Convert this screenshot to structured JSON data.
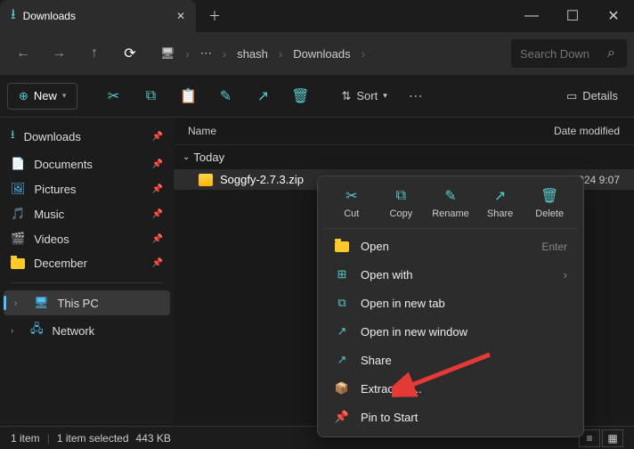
{
  "titlebar": {
    "tab_title": "Downloads"
  },
  "breadcrumb": {
    "dots": "⋯",
    "p1": "shash",
    "p2": "Downloads"
  },
  "search": {
    "placeholder": "Search Down"
  },
  "toolbar": {
    "new": "New",
    "sort": "Sort",
    "details": "Details"
  },
  "sidebar": {
    "items": [
      {
        "label": "Downloads",
        "icon": "download"
      },
      {
        "label": "Documents",
        "icon": "doc"
      },
      {
        "label": "Pictures",
        "icon": "pic"
      },
      {
        "label": "Music",
        "icon": "music"
      },
      {
        "label": "Videos",
        "icon": "video"
      },
      {
        "label": "December",
        "icon": "folder"
      }
    ],
    "thispc": "This PC",
    "network": "Network"
  },
  "columns": {
    "name": "Name",
    "date": "Date modified"
  },
  "group": "Today",
  "file": {
    "name": "Soggfy-2.7.3.zip",
    "date": "12/31/2024 9:07"
  },
  "ctx": {
    "cut": "Cut",
    "copy": "Copy",
    "rename": "Rename",
    "share": "Share",
    "delete": "Delete",
    "open": "Open",
    "open_hint": "Enter",
    "openwith": "Open with",
    "newtab": "Open in new tab",
    "newwin": "Open in new window",
    "share2": "Share",
    "extract": "Extract All...",
    "pin": "Pin to Start"
  },
  "status": {
    "count": "1 item",
    "sel": "1 item selected",
    "size": "443 KB"
  }
}
